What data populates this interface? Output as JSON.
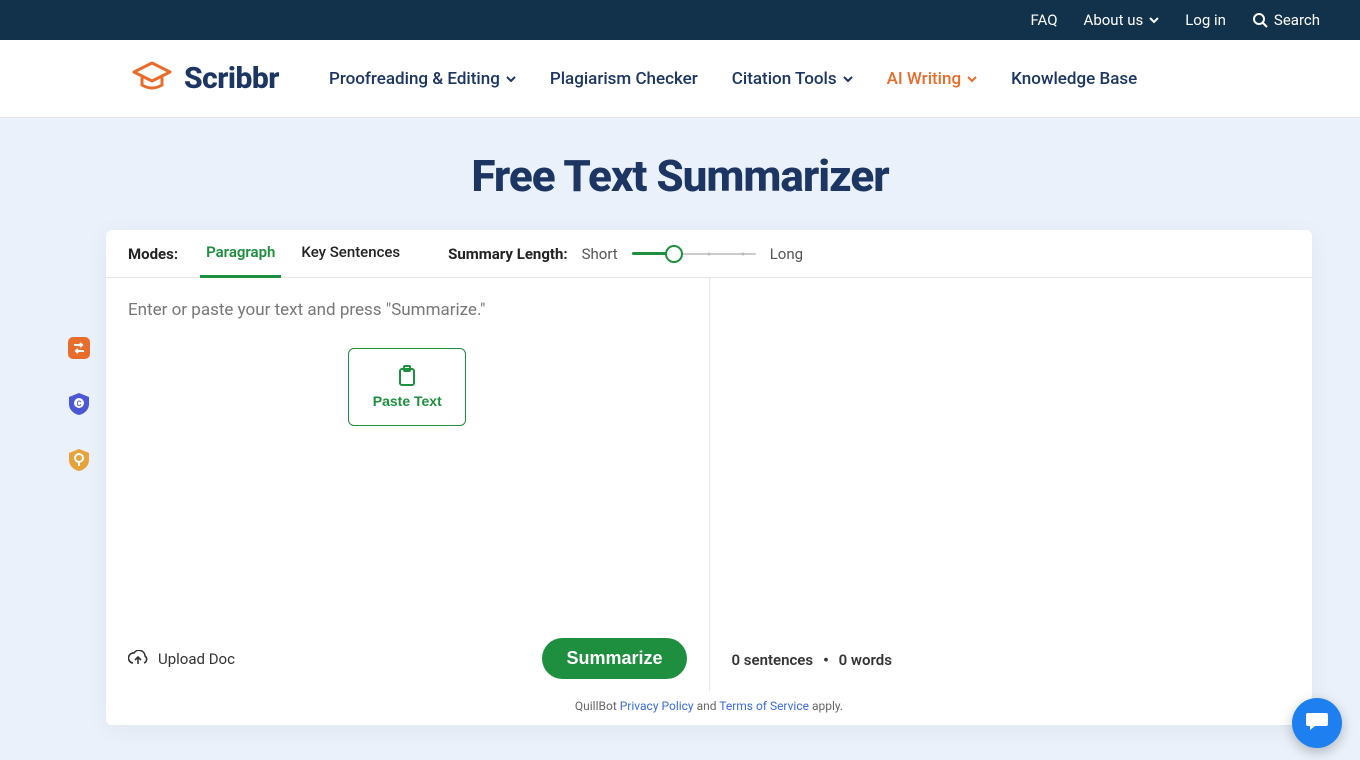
{
  "topbar": {
    "faq": "FAQ",
    "about": "About us",
    "login": "Log in",
    "search": "Search"
  },
  "brand": {
    "name": "Scribbr"
  },
  "nav": {
    "items": [
      {
        "label": "Proofreading & Editing",
        "dropdown": true,
        "active": false
      },
      {
        "label": "Plagiarism Checker",
        "dropdown": false,
        "active": false
      },
      {
        "label": "Citation Tools",
        "dropdown": true,
        "active": false
      },
      {
        "label": "AI Writing",
        "dropdown": true,
        "active": true
      },
      {
        "label": "Knowledge Base",
        "dropdown": false,
        "active": false
      }
    ]
  },
  "hero": {
    "title": "Free Text Summarizer"
  },
  "toolbar": {
    "modes_label": "Modes:",
    "modes": [
      {
        "label": "Paragraph",
        "active": true
      },
      {
        "label": "Key Sentences",
        "active": false
      }
    ],
    "summary_length_label": "Summary Length:",
    "summary_length_min": "Short",
    "summary_length_max": "Long"
  },
  "editor": {
    "placeholder": "Enter or paste your text and press \"Summarize.\"",
    "paste_label": "Paste Text",
    "upload_label": "Upload Doc",
    "summarize_label": "Summarize"
  },
  "output": {
    "sentences_count": "0 sentences",
    "words_count": "0 words"
  },
  "legal": {
    "prefix": "QuillBot ",
    "privacy": "Privacy Policy",
    "and": " and ",
    "terms": "Terms of Service",
    "suffix": " apply."
  }
}
